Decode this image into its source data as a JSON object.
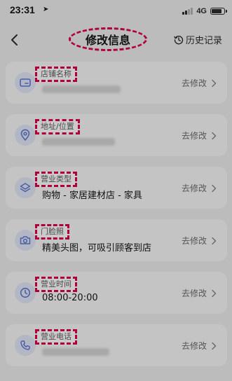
{
  "status_bar": {
    "time": "23:31",
    "network": "4G",
    "battery_level": 0.9
  },
  "nav": {
    "title": "修改信息",
    "history_label": "历史记录"
  },
  "rows": [
    {
      "label": "店铺名称",
      "value": "",
      "edit_label": "去修改",
      "icon": "store-card-icon"
    },
    {
      "label": "地址/位置",
      "value": "",
      "edit_label": "去修改",
      "icon": "location-pin-icon"
    },
    {
      "label": "营业类型",
      "value": "购物 - 家居建材店 - 家具",
      "edit_label": "去修改",
      "icon": "layers-icon"
    },
    {
      "label": "门脸照",
      "value": "精美头图，可吸引顾客到店",
      "edit_label": "去修改",
      "icon": "camera-icon"
    },
    {
      "label": "营业时间",
      "value": "08:00-20:00",
      "edit_label": "去修改",
      "icon": "clock-icon"
    },
    {
      "label": "营业电话",
      "value": "",
      "edit_label": "去修改",
      "icon": "phone-icon"
    }
  ]
}
